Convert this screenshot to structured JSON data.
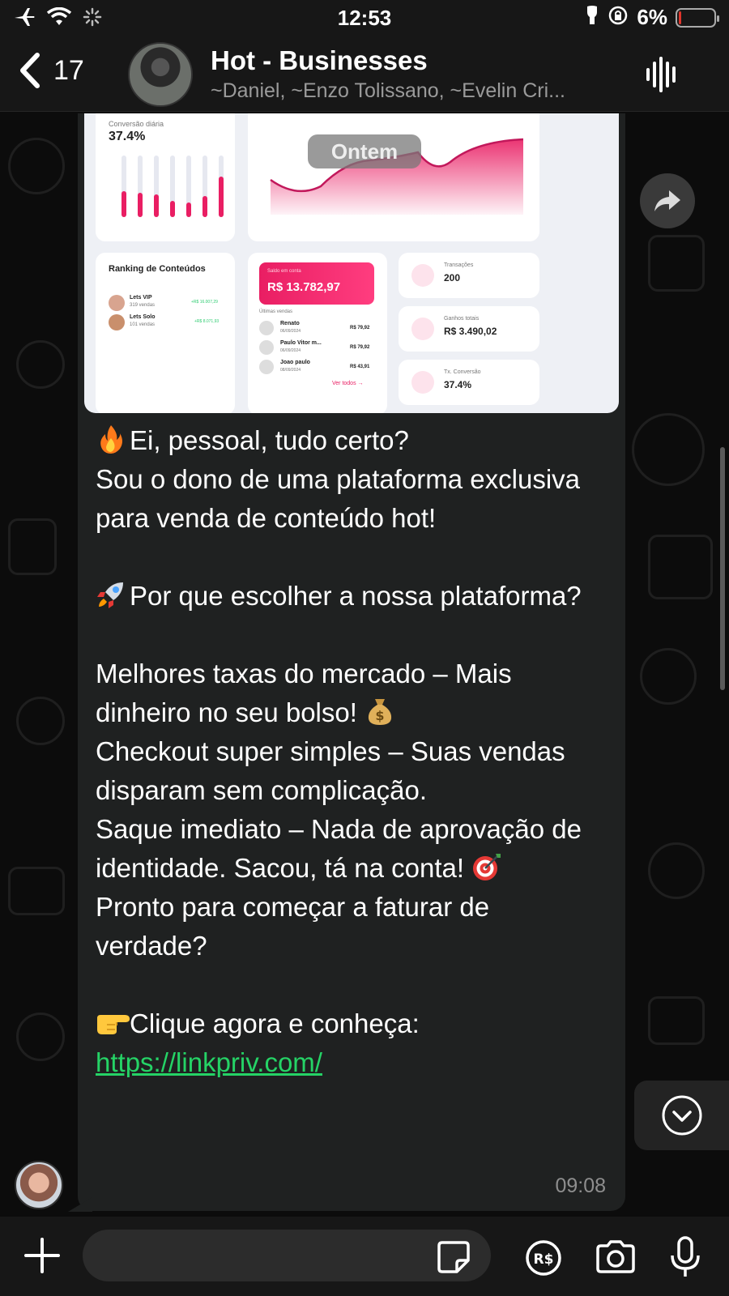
{
  "status_bar": {
    "time": "12:53",
    "battery_percent": "6%",
    "battery_level": 0.06,
    "icons": [
      "airplane-icon",
      "wifi-icon",
      "loading-icon",
      "flashlight-icon",
      "rotation-lock-icon",
      "battery-icon"
    ]
  },
  "header": {
    "back_count": "17",
    "title": "Hot - Businesses",
    "members": "~Daniel, ~Enzo Tolissano, ~Evelin Cri..."
  },
  "media": {
    "date_chip": "Ontem",
    "conversion_label": "Conversão diária",
    "conversion_value": "37.4%",
    "ranking_title": "Ranking de Conteúdos",
    "ranking": [
      {
        "name": "Lets VIP",
        "sales": "319 vendas",
        "amount": "+R$ 16.007,29"
      },
      {
        "name": "Lets Solo",
        "sales": "101 vendas",
        "amount": "+R$ 8.071,93"
      }
    ],
    "balance_label": "Saldo em conta",
    "balance_value": "R$ 13.782,97",
    "recent_sales_label": "Últimas vendas",
    "recent_sales": [
      {
        "name": "Renato",
        "date": "06/09/2024",
        "amount": "R$ 79,92"
      },
      {
        "name": "Paulo Vitor m...",
        "date": "06/09/2024",
        "amount": "R$ 79,92"
      },
      {
        "name": "Joao paulo",
        "date": "08/09/2024",
        "amount": "R$ 43,91"
      }
    ],
    "see_all": "Ver todos →",
    "stats": [
      {
        "label": "Transações",
        "value": "200"
      },
      {
        "label": "Ganhos totais",
        "value": "R$ 3.490,02"
      },
      {
        "label": "Tx. Conversão",
        "value": "37.4%"
      }
    ]
  },
  "message": {
    "lines": [
      {
        "emoji": "fire",
        "text": "Ei, pessoal, tudo certo?"
      },
      {
        "text": "Sou o dono de uma plataforma exclusiva para venda de conteúdo hot!"
      },
      {
        "text": ""
      },
      {
        "emoji": "rocket",
        "text": "Por que escolher a nossa plataforma?"
      },
      {
        "text": ""
      },
      {
        "text": "Melhores taxas do mercado – Mais dinheiro no seu bolso!",
        "emoji_after": "money-bag"
      },
      {
        "text": "Checkout super simples – Suas vendas disparam sem complicação."
      },
      {
        "text": "Saque imediato – Nada de aprovação de identidade. Sacou, tá na conta!",
        "emoji_after": "dart"
      },
      {
        "text": "Pronto para começar a faturar de verdade?"
      },
      {
        "text": ""
      },
      {
        "emoji": "pointing-hand",
        "text": "Clique agora e conheça: "
      }
    ],
    "link": "https://linkpriv.com/",
    "time": "09:08"
  },
  "composer": {
    "placeholder": "",
    "icons": [
      "plus-icon",
      "sticker-icon",
      "payment-icon",
      "camera-icon",
      "microphone-icon"
    ]
  },
  "colors": {
    "link": "#25d366",
    "bubble": "#1f2121",
    "accent_pink": "#e91e63"
  }
}
